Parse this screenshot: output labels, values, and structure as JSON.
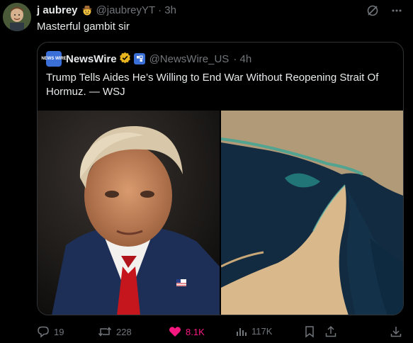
{
  "tweet": {
    "display_name": "j aubrey",
    "name_emoji_icon": "cowboy-hat-face-icon",
    "handle": "@jaubreyYT",
    "time": "· 3h",
    "text": "Masterful gambit sir"
  },
  "quote": {
    "avatar_text": "NEWS WIRE",
    "display_name": "NewsWire",
    "handle": "@NewsWire_US",
    "time": "· 4h",
    "text": "Trump Tells Aides He’s Willing to End War Without Reopening Strait Of Hormuz. — WSJ"
  },
  "actions": {
    "replies": "19",
    "reposts": "228",
    "likes": "8.1K",
    "views": "117K"
  },
  "colors": {
    "background": "#000000",
    "text": "#e7e9ea",
    "muted": "#71767b",
    "border": "#2f3336",
    "like": "#f91880",
    "verified_gold": "#e8b51f",
    "affiliate_blue": "#3b6fd8"
  }
}
